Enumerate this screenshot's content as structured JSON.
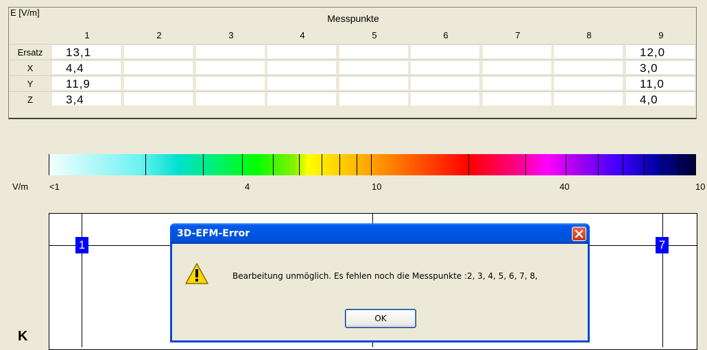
{
  "table": {
    "corner_label": "E [V/m]",
    "title": "Messpunkte",
    "columns": [
      "1",
      "2",
      "3",
      "4",
      "5",
      "6",
      "7",
      "8",
      "9"
    ],
    "rows": [
      {
        "label": "Ersatz",
        "values": [
          "13,1",
          "",
          "",
          "",
          "",
          "",
          "",
          "",
          "12,0"
        ]
      },
      {
        "label": "X",
        "values": [
          "4,4",
          "",
          "",
          "",
          "",
          "",
          "",
          "",
          "3,0"
        ]
      },
      {
        "label": "Y",
        "values": [
          "11,9",
          "",
          "",
          "",
          "",
          "",
          "",
          "",
          "11,0"
        ]
      },
      {
        "label": "Z",
        "values": [
          "3,4",
          "",
          "",
          "",
          "",
          "",
          "",
          "",
          "4,0"
        ]
      }
    ]
  },
  "scale": {
    "unit": "V/m",
    "labels": [
      "<1",
      "4",
      "10",
      "40",
      "10"
    ]
  },
  "diagram": {
    "markers": [
      "1",
      "7"
    ],
    "corner_letter": "K"
  },
  "dialog": {
    "title": "3D-EFM-Error",
    "message": "Bearbeitung unmöglich. Es fehlen noch die Messpunkte :2, 3, 4, 5, 6, 7, 8,",
    "ok_label": "OK",
    "icon": "warning-icon",
    "close_icon": "close-icon"
  }
}
